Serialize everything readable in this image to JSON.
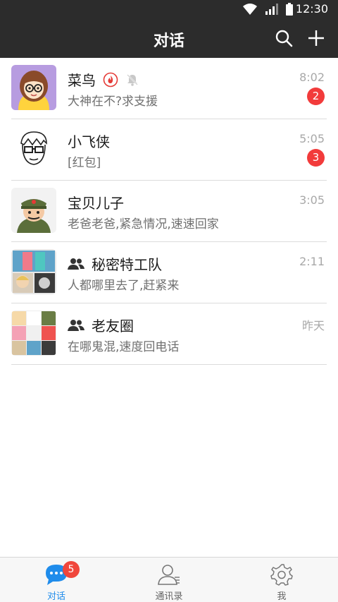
{
  "status_bar": {
    "time": "12:30"
  },
  "header": {
    "title": "对话"
  },
  "conversations": [
    {
      "name": "菜鸟",
      "preview": "大神在不?求支援",
      "time": "8:02",
      "unread": "2"
    },
    {
      "name": "小飞侠",
      "preview": "[红包]",
      "time": "5:05",
      "unread": "3"
    },
    {
      "name": "宝贝儿子",
      "preview": "老爸老爸,紧急情况,速速回家",
      "time": "3:05"
    },
    {
      "name": "秘密特工队",
      "preview": "人都哪里去了,赶紧来",
      "time": "2:11"
    },
    {
      "name": "老友圈",
      "preview": "在哪鬼混,速度回电话",
      "time": "昨天"
    }
  ],
  "tabs": [
    {
      "label": "对话",
      "badge": "5",
      "active": true
    },
    {
      "label": "通讯录"
    },
    {
      "label": "我"
    }
  ],
  "colors": {
    "header_bg": "#2c2c2c",
    "badge_red": "#f23b3b",
    "active_tab": "#1f8ceb"
  },
  "icons": [
    "search-icon",
    "add-icon",
    "hot-icon",
    "mute-icon",
    "group-icon",
    "chat-bubble-icon",
    "contacts-icon",
    "settings-icon"
  ]
}
